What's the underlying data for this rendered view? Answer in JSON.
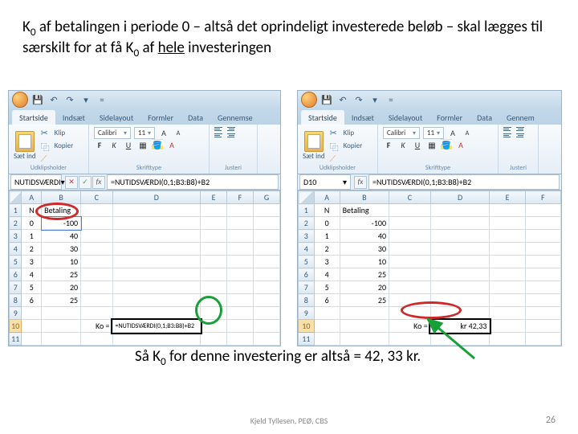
{
  "heading": {
    "pre1": "K",
    "sub1": "0",
    "mid1": " af betalingen i periode 0 – altså det oprindeligt investerede beløb – skal lægges til særskilt for at få K",
    "sub2": "0",
    "mid2": " af ",
    "ul": "hele",
    "post": " investeringen"
  },
  "qat": {
    "save": "💾",
    "undo": "↶",
    "redo": "↷",
    "more": "▾",
    "eq": "="
  },
  "tabs": [
    "Startside",
    "Indsæt",
    "Sidelayout",
    "Formler",
    "Data",
    "Gennemse"
  ],
  "tabs_right": [
    "Startside",
    "Indsæt",
    "Sidelayout",
    "Formler",
    "Data",
    "Gennem"
  ],
  "ribbon": {
    "paste_label": "Sæt ind",
    "klip": "Klip",
    "kopier": "Kopier",
    "group1": "Udklipsholder",
    "font": "Calibri",
    "fontsize": "11",
    "group2": "Skrifttype",
    "group3": "Justeri"
  },
  "left": {
    "namebox": "NUTIDSVÆRDI",
    "formula_pre": "=NUTIDSVÆRDI(0,1;B3:B8)",
    "formula_plus": "+B2",
    "cols": [
      "",
      "A",
      "B",
      "C",
      "D",
      "E",
      "F",
      "G"
    ],
    "rows": [
      {
        "n": "1",
        "a": "N",
        "b": "Betaling"
      },
      {
        "n": "2",
        "a": "0",
        "b": "-100"
      },
      {
        "n": "3",
        "a": "1",
        "b": "40"
      },
      {
        "n": "4",
        "a": "2",
        "b": "30"
      },
      {
        "n": "5",
        "a": "3",
        "b": "10"
      },
      {
        "n": "6",
        "a": "4",
        "b": "25"
      },
      {
        "n": "7",
        "a": "5",
        "b": "20"
      },
      {
        "n": "8",
        "a": "6",
        "b": "25"
      },
      {
        "n": "9",
        "a": "",
        "b": ""
      },
      {
        "n": "10",
        "a": "",
        "b": "",
        "c": "Ko =",
        "d": "=NUTIDSVÆRDI(0,1;B3:B8)+B2"
      },
      {
        "n": "11"
      }
    ]
  },
  "right": {
    "namebox": "D10",
    "formula": "=NUTIDSVÆRDI(0,1;B3:B8)+B2",
    "cols": [
      "",
      "A",
      "B",
      "C",
      "D",
      "E",
      "F"
    ],
    "rows": [
      {
        "n": "1",
        "a": "N",
        "b": "Betaling"
      },
      {
        "n": "2",
        "a": "0",
        "b": "-100"
      },
      {
        "n": "3",
        "a": "1",
        "b": "40"
      },
      {
        "n": "4",
        "a": "2",
        "b": "30"
      },
      {
        "n": "5",
        "a": "3",
        "b": "10"
      },
      {
        "n": "6",
        "a": "4",
        "b": "25"
      },
      {
        "n": "7",
        "a": "5",
        "b": "20"
      },
      {
        "n": "8",
        "a": "6",
        "b": "25"
      },
      {
        "n": "9"
      },
      {
        "n": "10",
        "c": "Ko =",
        "d": "kr 42,33"
      },
      {
        "n": "11"
      }
    ]
  },
  "bottom": {
    "pre": "Så K",
    "sub": "0",
    "post": " for denne investering er altså = 42, 33 kr."
  },
  "footer": "Kjeld Tyllesen, PEØ, CBS",
  "page": "26"
}
